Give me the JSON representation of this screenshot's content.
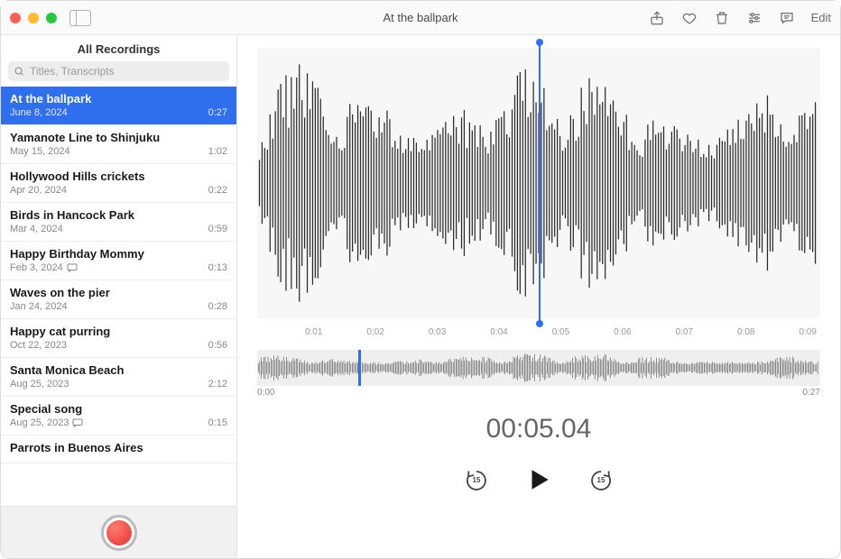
{
  "window": {
    "title": "At the ballpark",
    "edit_label": "Edit",
    "sidebar_title": "All Recordings"
  },
  "search": {
    "placeholder": "Titles, Transcripts",
    "value": ""
  },
  "recordings": [
    {
      "title": "At the ballpark",
      "date": "June 8, 2024",
      "duration": "0:27",
      "selected": true,
      "transcript": false
    },
    {
      "title": "Yamanote Line to Shinjuku",
      "date": "May 15, 2024",
      "duration": "1:02",
      "selected": false,
      "transcript": false
    },
    {
      "title": "Hollywood Hills crickets",
      "date": "Apr 20, 2024",
      "duration": "0:22",
      "selected": false,
      "transcript": false
    },
    {
      "title": "Birds in Hancock Park",
      "date": "Mar 4, 2024",
      "duration": "0:59",
      "selected": false,
      "transcript": false
    },
    {
      "title": "Happy Birthday Mommy",
      "date": "Feb 3, 2024",
      "duration": "0:13",
      "selected": false,
      "transcript": true
    },
    {
      "title": "Waves on the pier",
      "date": "Jan 24, 2024",
      "duration": "0:28",
      "selected": false,
      "transcript": false
    },
    {
      "title": "Happy cat purring",
      "date": "Oct 22, 2023",
      "duration": "0:56",
      "selected": false,
      "transcript": false
    },
    {
      "title": "Santa Monica Beach",
      "date": "Aug 25, 2023",
      "duration": "2:12",
      "selected": false,
      "transcript": false
    },
    {
      "title": "Special song",
      "date": "Aug 25, 2023",
      "duration": "0:15",
      "selected": false,
      "transcript": true
    },
    {
      "title": "Parrots in Buenos Aires",
      "date": "",
      "duration": "",
      "selected": false,
      "transcript": false
    }
  ],
  "detail": {
    "timeline_ticks": [
      "",
      "0:01",
      "0:02",
      "0:03",
      "0:04",
      "0:05",
      "0:06",
      "0:07",
      "0:08",
      "0:09"
    ],
    "overview_start": "0:00",
    "overview_end": "0:27",
    "current_time": "00:05.04",
    "playhead_pct": 50,
    "overview_playhead_pct": 18,
    "skip_seconds": "15"
  },
  "colors": {
    "accent": "#2f6fed",
    "record": "#e5332d"
  }
}
